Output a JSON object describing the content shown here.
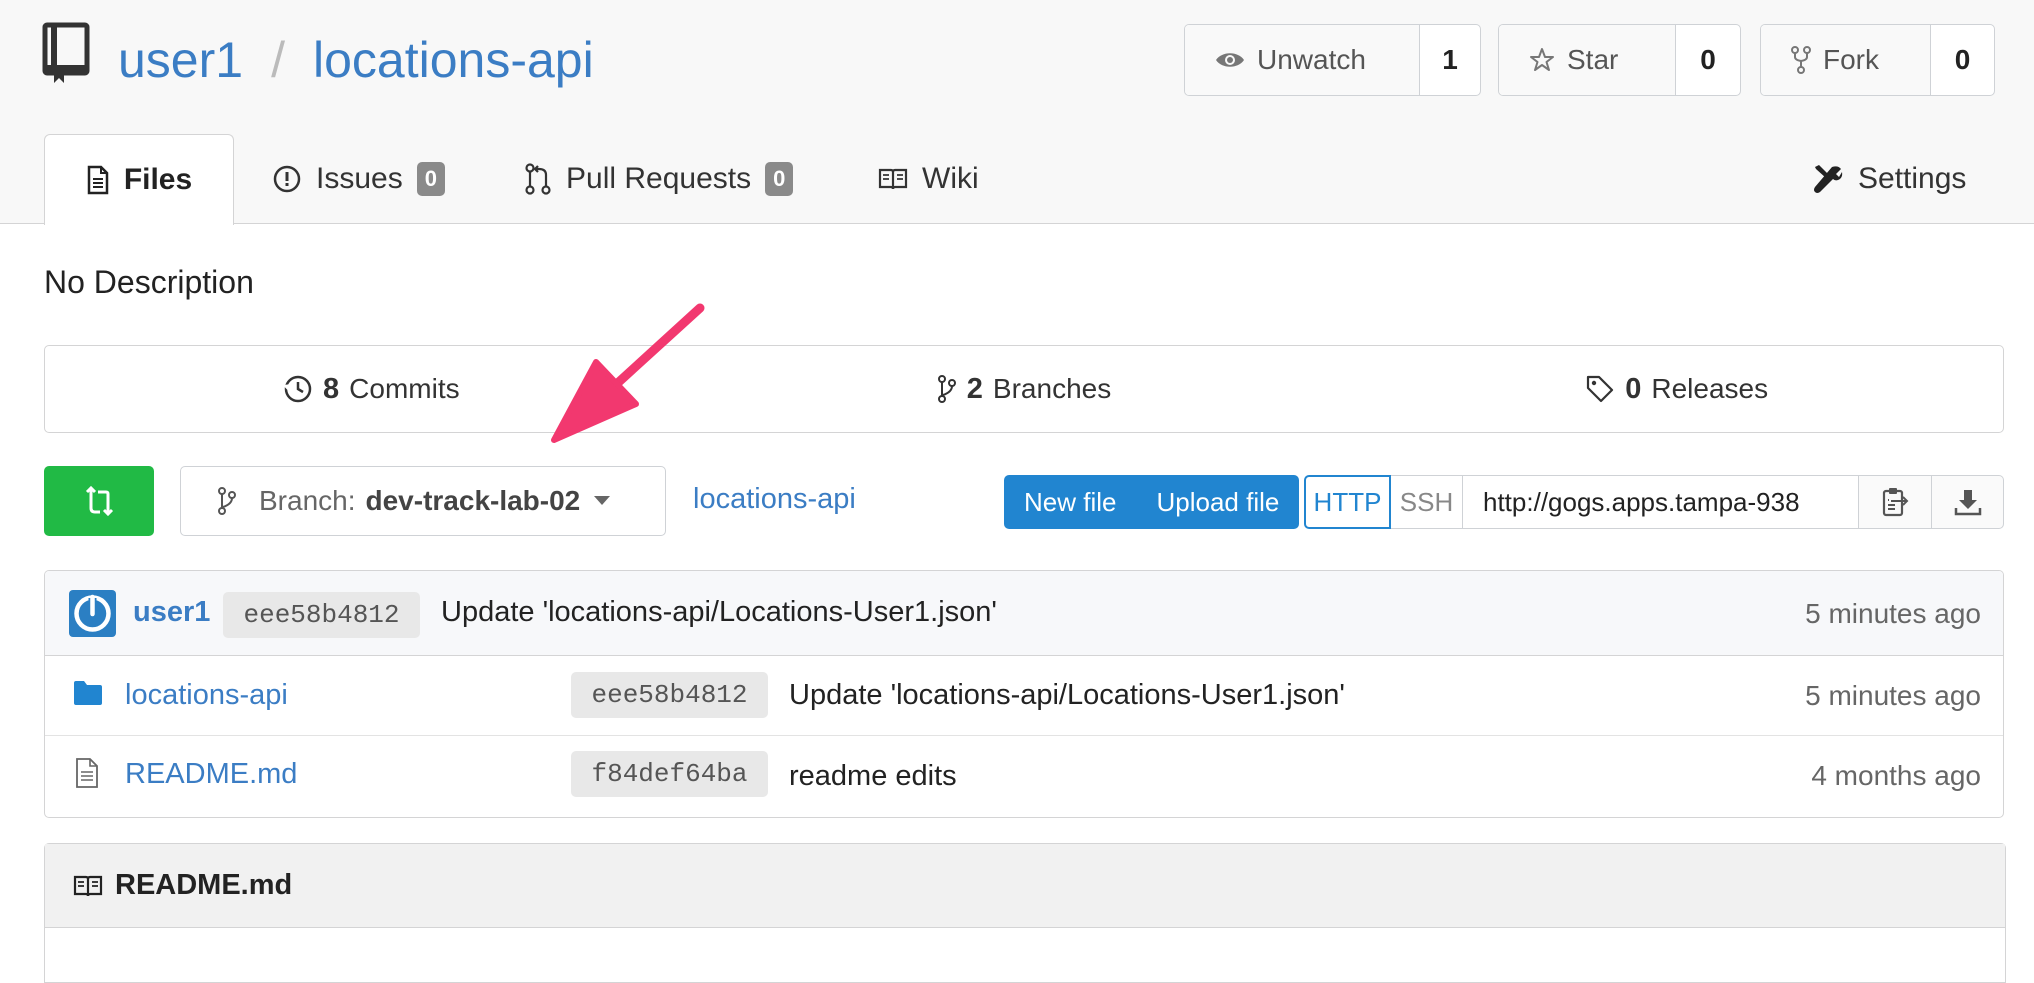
{
  "repo": {
    "owner": "user1",
    "name": "locations-api",
    "separator": "/"
  },
  "actions": {
    "unwatch": {
      "label": "Unwatch",
      "count": "1"
    },
    "star": {
      "label": "Star",
      "count": "0"
    },
    "fork": {
      "label": "Fork",
      "count": "0"
    }
  },
  "tabs": {
    "files": "Files",
    "issues": {
      "label": "Issues",
      "count": "0"
    },
    "pulls": {
      "label": "Pull Requests",
      "count": "0"
    },
    "wiki": "Wiki",
    "settings": "Settings"
  },
  "description": "No Description",
  "stats": {
    "commits": {
      "count": "8",
      "label": "Commits"
    },
    "branches": {
      "count": "2",
      "label": "Branches"
    },
    "releases": {
      "count": "0",
      "label": "Releases"
    }
  },
  "branch": {
    "prefix": "Branch:",
    "name": "dev-track-lab-02"
  },
  "path_link": "locations-api",
  "file_buttons": {
    "new_file": "New file",
    "upload_file": "Upload file"
  },
  "clone": {
    "http": "HTTP",
    "ssh": "SSH",
    "url": "http://gogs.apps.tampa-938"
  },
  "last_commit": {
    "author": "user1",
    "sha": "eee58b4812",
    "message": "Update 'locations-api/Locations-User1.json'",
    "time": "5 minutes ago"
  },
  "files": [
    {
      "name": "locations-api",
      "type": "folder",
      "sha": "eee58b4812",
      "message": "Update 'locations-api/Locations-User1.json'",
      "time": "5 minutes ago"
    },
    {
      "name": "README.md",
      "type": "file",
      "sha": "f84def64ba",
      "message": "readme edits",
      "time": "4 months ago"
    }
  ],
  "readme": {
    "title": "README.md"
  },
  "colors": {
    "link": "#3b7dc4",
    "primary": "#2185d0",
    "green": "#21ba45",
    "arrow": "#f2386f"
  }
}
